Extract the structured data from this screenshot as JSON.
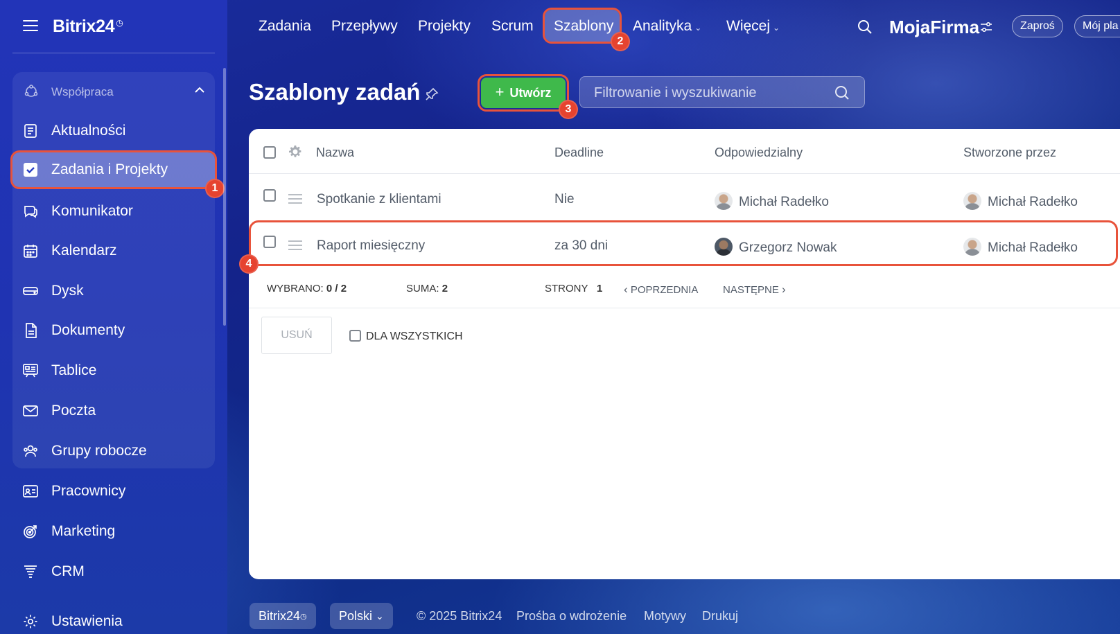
{
  "app": {
    "logo": "Bitrix24",
    "logo_mark": "◷"
  },
  "sidebar": {
    "group_label": "Współpraca",
    "items": [
      {
        "label": "Aktualności",
        "icon": "news-icon"
      },
      {
        "label": "Zadania i Projekty",
        "icon": "task-check-icon",
        "active": true
      },
      {
        "label": "Komunikator",
        "icon": "chat-icon"
      },
      {
        "label": "Kalendarz",
        "icon": "calendar-icon"
      },
      {
        "label": "Dysk",
        "icon": "disk-icon"
      },
      {
        "label": "Dokumenty",
        "icon": "document-icon"
      },
      {
        "label": "Tablice",
        "icon": "board-icon"
      },
      {
        "label": "Poczta",
        "icon": "mail-icon"
      },
      {
        "label": "Grupy robocze",
        "icon": "group-icon"
      },
      {
        "label": "Pracownicy",
        "icon": "employees-icon"
      },
      {
        "label": "Marketing",
        "icon": "marketing-icon"
      },
      {
        "label": "CRM",
        "icon": "crm-icon"
      },
      {
        "label": "Ustawienia",
        "icon": "gear-icon"
      }
    ]
  },
  "topnav": {
    "tabs": [
      {
        "label": "Zadania"
      },
      {
        "label": "Przepływy"
      },
      {
        "label": "Projekty"
      },
      {
        "label": "Scrum"
      },
      {
        "label": "Szablony",
        "active": true
      },
      {
        "label": "Analityka"
      },
      {
        "label": "Więcej"
      }
    ],
    "company": "MojaFirma",
    "invite": "Zaproś",
    "plan": "Mój pla"
  },
  "badges": {
    "b1": "1",
    "b2": "2",
    "b3": "3",
    "b4": "4"
  },
  "page": {
    "title": "Szablony zadań",
    "create_label": "Utwórz",
    "filter_placeholder": "Filtrowanie i wyszukiwanie"
  },
  "table": {
    "columns": {
      "name": "Nazwa",
      "deadline": "Deadline",
      "responsible": "Odpowiedzialny",
      "created_by": "Stworzone przez"
    },
    "rows": [
      {
        "name": "Spotkanie z klientami",
        "deadline": "Nie",
        "responsible": "Michał Radełko",
        "created_by": "Michał Radełko"
      },
      {
        "name": "Raport miesięczny",
        "deadline": "za 30 dni",
        "responsible": "Grzegorz Nowak",
        "created_by": "Michał Radełko"
      }
    ],
    "footer": {
      "selected_label": "WYBRANO:",
      "selected_value": "0 / 2",
      "total_label": "SUMA:",
      "total_value": "2",
      "pages_label": "STRONY",
      "pages_value": "1",
      "prev": "POPRZEDNIA",
      "next": "NASTĘPNE"
    },
    "actions": {
      "delete": "USUŃ",
      "for_all": "DLA WSZYSTKICH"
    }
  },
  "footer": {
    "brand": "Bitrix24",
    "language": "Polski",
    "copyright": "© 2025 Bitrix24",
    "links": [
      "Prośba o wdrożenie",
      "Motywy",
      "Drukuj"
    ]
  },
  "colors": {
    "accent_green": "#3fb94b",
    "highlight_red": "#e8533b",
    "badge_red": "#e6432f"
  }
}
